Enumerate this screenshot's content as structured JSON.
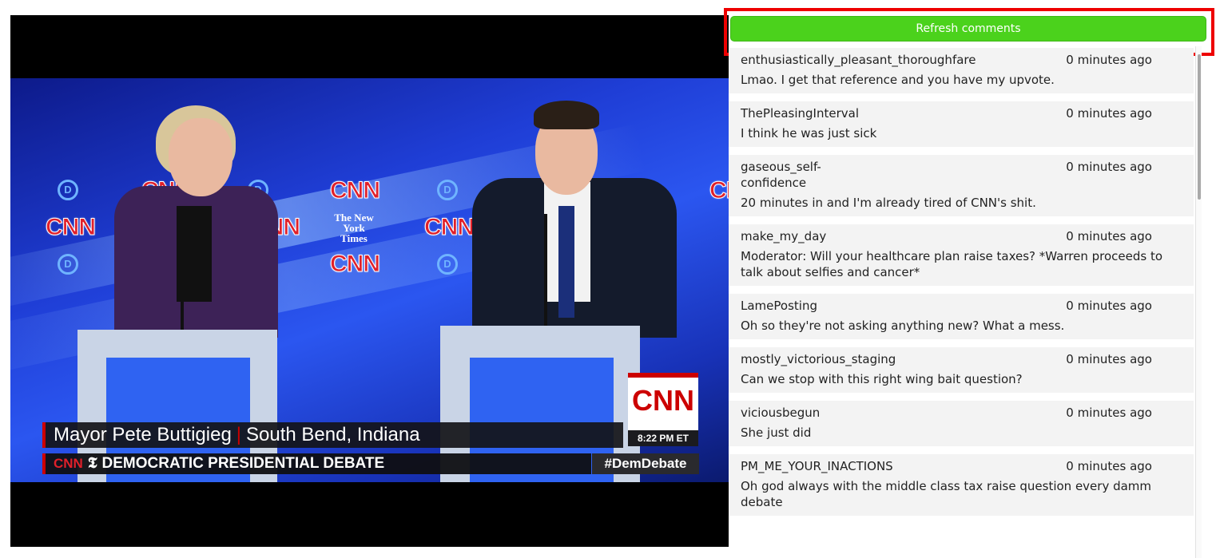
{
  "video": {
    "chyron_name": "Mayor Pete Buttigieg",
    "chyron_location": "South Bend, Indiana",
    "chyron_title": "DEMOCRATIC PRESIDENTIAL DEBATE",
    "chyron_logo": "CNN",
    "hashtag": "#DemDebate",
    "bug_logo": "CNN",
    "bug_time": "8:22 PM ET",
    "backdrop_logo": "CNN",
    "backdrop_dem": "D",
    "backdrop_nyt": "The New York Times"
  },
  "comments_panel": {
    "refresh_label": "Refresh comments",
    "refresh_color": "#4bd21c",
    "highlight_color": "#ee0000",
    "comments": [
      {
        "user": "enthusiastically_pleasant_thoroughfare",
        "time": "0 minutes ago",
        "text": "Lmao. I get that reference and you have my upvote."
      },
      {
        "user": "ThePleasingInterval",
        "time": "0 minutes ago",
        "text": "I think he was just sick"
      },
      {
        "user": "gaseous_self-confidence",
        "time": "0 minutes ago",
        "text": "20 minutes in and I'm already tired of CNN's shit."
      },
      {
        "user": "make_my_day",
        "time": "0 minutes ago",
        "text": "Moderator: Will your healthcare plan raise taxes? *Warren proceeds to talk about selfies and cancer*"
      },
      {
        "user": "LamePosting",
        "time": "0 minutes ago",
        "text": "Oh so they're not asking anything new? What a mess."
      },
      {
        "user": "mostly_victorious_staging",
        "time": "0 minutes ago",
        "text": "Can we stop with this right wing bait question?"
      },
      {
        "user": "viciousbegun",
        "time": "0 minutes ago",
        "text": "She just did"
      },
      {
        "user": "PM_ME_YOUR_INACTIONS",
        "time": "0 minutes ago",
        "text": "Oh god always with the middle class tax raise question every damm debate"
      }
    ]
  }
}
